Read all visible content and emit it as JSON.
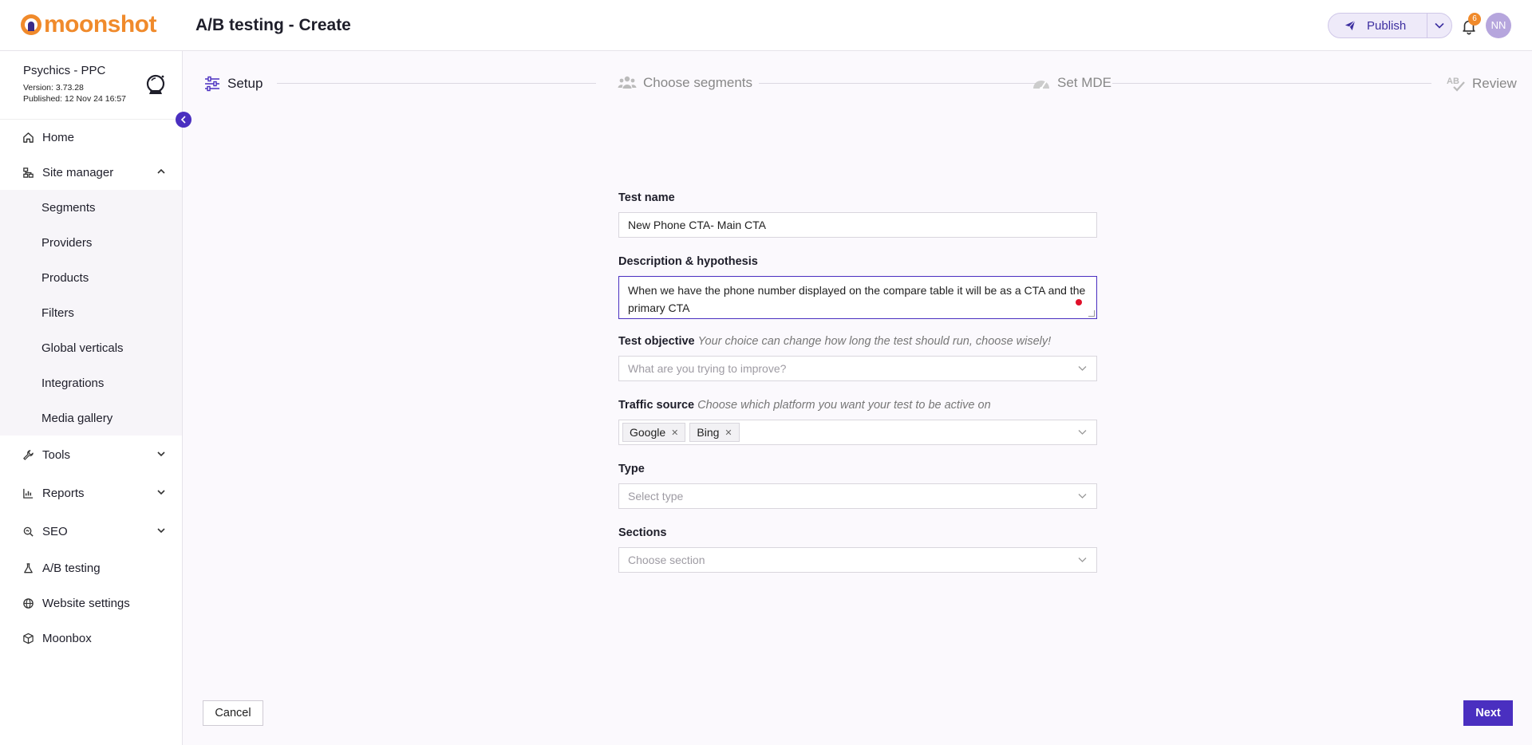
{
  "app": {
    "logo_text": "moonshot",
    "page_title": "A/B testing - Create"
  },
  "header": {
    "publish_label": "Publish",
    "notification_count": "6",
    "avatar_initials": "NN"
  },
  "site": {
    "name": "Psychics - PPC",
    "version": "Version: 3.73.28",
    "published": "Published: 12 Nov 24 16:57"
  },
  "sidebar": {
    "items": [
      {
        "label": "Home",
        "icon": "home-icon"
      },
      {
        "label": "Site manager",
        "icon": "sitemap-icon",
        "expanded": true
      },
      {
        "label": "Tools",
        "icon": "wrench-icon"
      },
      {
        "label": "Reports",
        "icon": "chart-icon"
      },
      {
        "label": "SEO",
        "icon": "seo-icon"
      },
      {
        "label": "A/B testing",
        "icon": "flask-icon"
      },
      {
        "label": "Website settings",
        "icon": "globe-icon"
      },
      {
        "label": "Moonbox",
        "icon": "box-icon"
      }
    ],
    "site_manager_children": [
      "Segments",
      "Providers",
      "Products",
      "Filters",
      "Global verticals",
      "Integrations",
      "Media gallery"
    ]
  },
  "stepper": {
    "steps": [
      {
        "label": "Setup",
        "active": true
      },
      {
        "label": "Choose segments",
        "active": false
      },
      {
        "label": "Set MDE",
        "active": false
      },
      {
        "label": "Review",
        "active": false
      }
    ]
  },
  "form": {
    "test_name_label": "Test name",
    "test_name_value": "New Phone CTA- Main CTA",
    "description_label": "Description & hypothesis",
    "description_value": "When we have the phone number displayed on the compare table it will be as a CTA and the primary CTA",
    "objective_label": "Test objective",
    "objective_hint": "Your choice can change how long the test should run, choose wisely!",
    "objective_placeholder": "What are you trying to improve?",
    "traffic_label": "Traffic source",
    "traffic_hint": "Choose which platform you want your test to be active on",
    "traffic_tags": [
      "Google",
      "Bing"
    ],
    "type_label": "Type",
    "type_placeholder": "Select type",
    "sections_label": "Sections",
    "sections_placeholder": "Choose section"
  },
  "footer": {
    "cancel_label": "Cancel",
    "next_label": "Next"
  },
  "colors": {
    "accent": "#4a2fc0",
    "brand": "#f08a2b"
  }
}
